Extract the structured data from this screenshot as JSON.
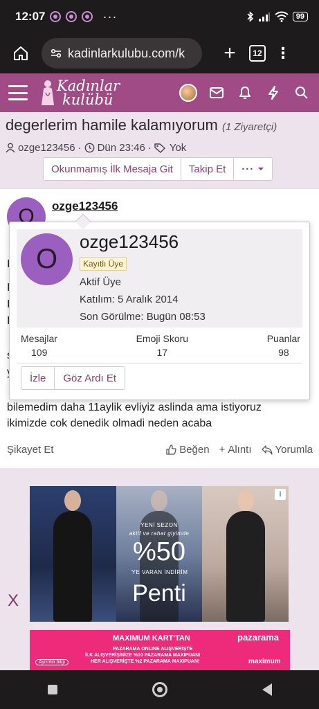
{
  "status_bar": {
    "time": "12:07",
    "more": "···",
    "battery": "99"
  },
  "browser": {
    "url": "kadinlarkulubu.com/k",
    "plus": "+",
    "tab_count": "12",
    "menu": "⋮"
  },
  "site": {
    "logo_line1": "Kadınlar",
    "logo_line2": "kulübü"
  },
  "thread": {
    "title": "degerlerim hamile kalamıyorum",
    "visitors": "(1 Ziyaretçi)",
    "author": "ozge123456",
    "date": "Dün 23:46",
    "tags": "Yok",
    "actions": {
      "unread": "Okunmamış İlk Mesaja Git",
      "follow": "Takip Et",
      "more": "···"
    }
  },
  "post": {
    "avatar_letter": "O",
    "username": "ozge123456",
    "body_line1": "bilemedim daha 11aylik evliyiz aslinda ama istiyoruz",
    "body_line2": "ikimizde cok denedik olmadi neden acaba",
    "report": "Şikayet Et",
    "like": "Beğen",
    "quote": "Alıntı",
    "reply": "Yorumla",
    "left_letters": [
      "I",
      "I",
      "I",
      "I",
      "s",
      "y"
    ]
  },
  "member_card": {
    "avatar_letter": "O",
    "name": "ozge123456",
    "badge": "Kayıtlı Üye",
    "title": "Aktif Üye",
    "joined": "Katılım: 5 Aralık 2014",
    "last_seen": "Son Görülme: Bugün 08:53",
    "stats": [
      {
        "label": "Mesajlar",
        "value": "109"
      },
      {
        "label": "Emoji Skoru",
        "value": "17"
      },
      {
        "label": "Puanlar",
        "value": "98"
      }
    ],
    "buttons": {
      "watch": "İzle",
      "ignore": "Göz Ardı Et"
    }
  },
  "ads": {
    "close": "X",
    "banner1": {
      "line1": "YENİ SEZON",
      "line2": "aktif ve rahat giyimde",
      "percent": "%50",
      "line3": "'YE VARAN İNDİRİM",
      "brand": "Penti"
    },
    "banner2": {
      "title": "MAXIMUM KART'TAN",
      "line1": "PAZARAMA ONLINE ALIŞVERİŞTE",
      "line2": "İLK ALIŞVERİŞİNİZE %10 PAZARAMA MAXIPUAN!",
      "line3": "HER ALIŞVERİŞTE %2 PAZARAMA MAXIPUAN!",
      "brand": "pazarama",
      "brand2": "maximum",
      "info": "Ayrıntılı bilgi"
    }
  },
  "colors": {
    "header_bg": "#a04a86",
    "accent_link": "#8a3d76",
    "thread_bg": "#ece3ec",
    "avatar": "#9b5fc0"
  }
}
